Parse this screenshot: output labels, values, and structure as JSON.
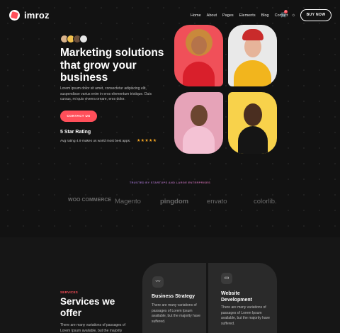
{
  "brand": {
    "name": "imroz"
  },
  "nav": {
    "items": [
      "Home",
      "About",
      "Pages",
      "Elements",
      "Blog",
      "Contact"
    ],
    "cart_count": "0",
    "cta": "BUY NOW"
  },
  "hero": {
    "title": "Marketing solutions that grow your business",
    "description": "Lorem ipsum dolor sit amet, consectetur adipiscing elit, suspendisse varius enim in eros elementum tristique. Duis cursus, mi quis viverra ornare, eros dolor.",
    "cta": "CONTACT US",
    "rating_title": "5 Star Rating",
    "rating_text": "Avg rating 4.9 makes us world most best apps.",
    "stars": "★★★★★"
  },
  "trusted": {
    "label": "TRUSTED BY STARTUPS AND LARGE ENTERPRISES",
    "brands": [
      "WOO COMMERCE",
      "Magento",
      "pingdom",
      "envato",
      "colorlib."
    ]
  },
  "services": {
    "label": "SERVICES",
    "title": "Services we offer",
    "description": "There are many variations of passages of Lorem Ipsum available, but the majority",
    "cards": [
      {
        "title": "Business Strategy",
        "description": "There are many variations of passages of Lorem Ipsum available, but the majority have suffered.",
        "icon": "pulse-icon"
      },
      {
        "title": "Website Development",
        "description": "There are many variations of passages of Lorem Ipsum available, but the majority have suffered.",
        "icon": "monitor-icon"
      }
    ]
  },
  "colors": {
    "accent": "#ff4f5a",
    "background": "#121212",
    "card": "#2a2a2a"
  }
}
